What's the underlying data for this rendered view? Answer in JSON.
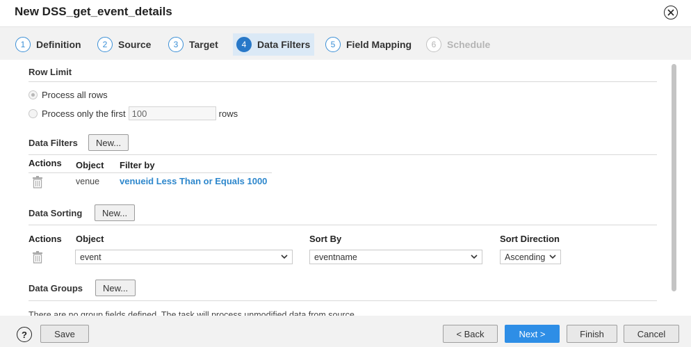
{
  "title": "New DSS_get_event_details",
  "steps": [
    {
      "num": "1",
      "label": "Definition"
    },
    {
      "num": "2",
      "label": "Source"
    },
    {
      "num": "3",
      "label": "Target"
    },
    {
      "num": "4",
      "label": "Data Filters"
    },
    {
      "num": "5",
      "label": "Field Mapping"
    },
    {
      "num": "6",
      "label": "Schedule"
    }
  ],
  "row_limit": {
    "heading": "Row Limit",
    "option_all": "Process all rows",
    "option_first": "Process only the first",
    "first_value": "100",
    "rows_suffix": "rows"
  },
  "data_filters": {
    "heading": "Data Filters",
    "new_label": "New...",
    "columns": [
      "Actions",
      "Object",
      "Filter by"
    ],
    "rows": [
      {
        "object": "venue",
        "filter": "venueid Less Than or Equals 1000"
      }
    ]
  },
  "data_sorting": {
    "heading": "Data Sorting",
    "new_label": "New...",
    "columns": [
      "Actions",
      "Object",
      "Sort By",
      "Sort Direction"
    ],
    "rows": [
      {
        "object": "event",
        "sort_by": "eventname",
        "direction": "Ascending"
      }
    ]
  },
  "data_groups": {
    "heading": "Data Groups",
    "new_label": "New...",
    "note": "There are no group fields defined. The task will process unmodified data from source."
  },
  "footer": {
    "help": "?",
    "save": "Save",
    "back": "< Back",
    "next": "Next >",
    "finish": "Finish",
    "cancel": "Cancel"
  },
  "colors": {
    "accent": "#2e8ee6",
    "link": "#2d87cc",
    "active_step_bg": "#dbe9f6"
  }
}
